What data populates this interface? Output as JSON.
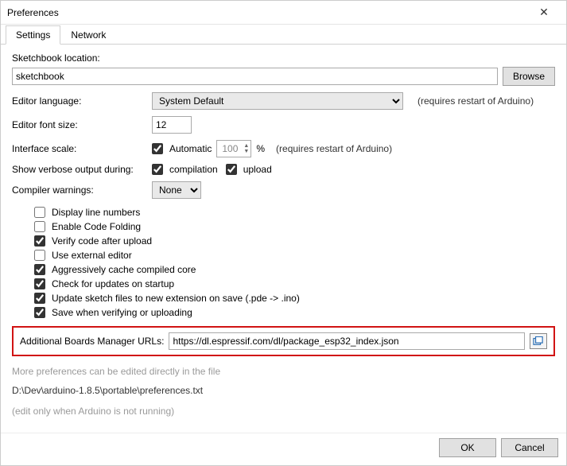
{
  "window": {
    "title": "Preferences"
  },
  "tabs": {
    "settings": "Settings",
    "network": "Network"
  },
  "sketchbook": {
    "label": "Sketchbook location:",
    "value": "sketchbook",
    "browse": "Browse"
  },
  "language": {
    "label": "Editor language:",
    "value": "System Default",
    "note": "(requires restart of Arduino)"
  },
  "fontsize": {
    "label": "Editor font size:",
    "value": "12"
  },
  "scale": {
    "label": "Interface scale:",
    "auto_label": "Automatic",
    "value": "100",
    "percent": "%",
    "note": "(requires restart of Arduino)"
  },
  "verbose": {
    "label": "Show verbose output during:",
    "compilation": "compilation",
    "upload": "upload"
  },
  "warnings": {
    "label": "Compiler warnings:",
    "value": "None"
  },
  "opts": {
    "display_line_numbers": "Display line numbers",
    "code_folding": "Enable Code Folding",
    "verify_after_upload": "Verify code after upload",
    "external_editor": "Use external editor",
    "cache_core": "Aggressively cache compiled core",
    "check_updates": "Check for updates on startup",
    "update_ext": "Update sketch files to new extension on save (.pde -> .ino)",
    "save_verify": "Save when verifying or uploading"
  },
  "boards": {
    "label": "Additional Boards Manager URLs:",
    "value": "https://dl.espressif.com/dl/package_esp32_index.json"
  },
  "hints": {
    "more": "More preferences can be edited directly in the file",
    "path": "D:\\Dev\\arduino-1.8.5\\portable\\preferences.txt",
    "edit_only": "(edit only when Arduino is not running)"
  },
  "buttons": {
    "ok": "OK",
    "cancel": "Cancel"
  }
}
